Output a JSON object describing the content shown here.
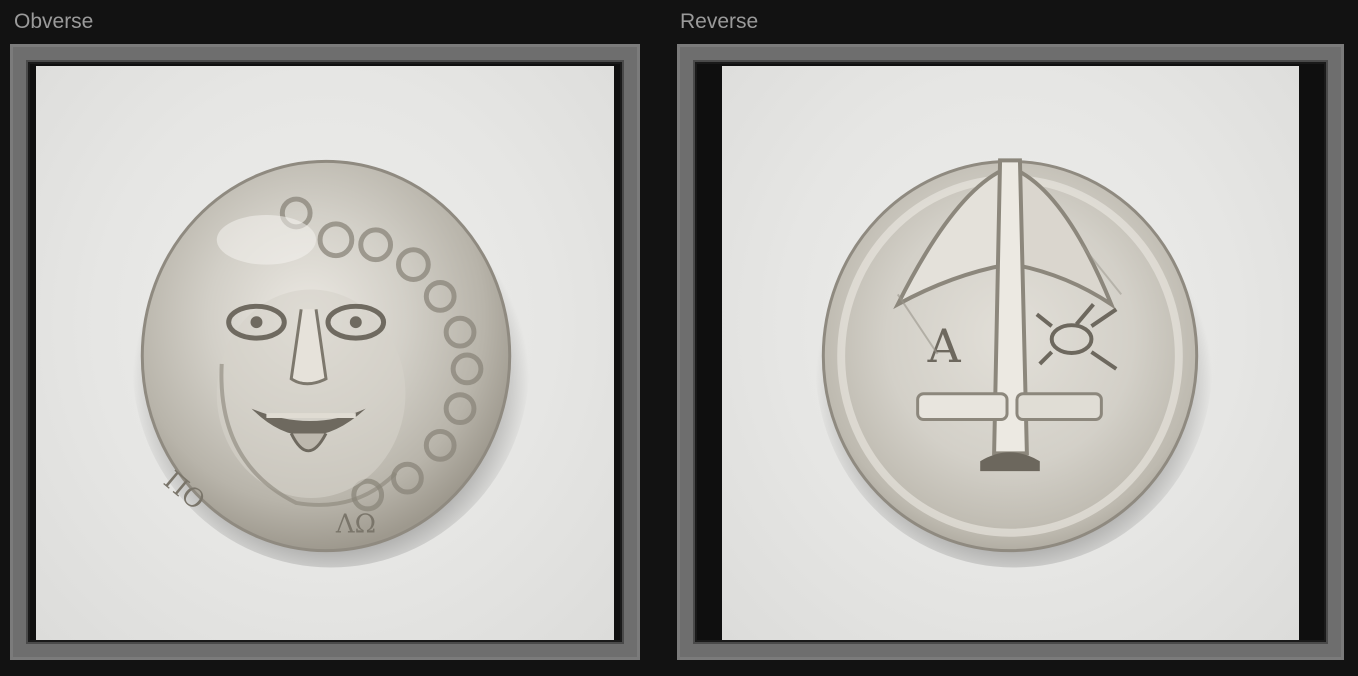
{
  "viewer": {
    "obverse": {
      "label": "Obverse",
      "image_alt": "Silver coin obverse with facing gorgoneion (Medusa head)"
    },
    "reverse": {
      "label": "Reverse",
      "image_alt": "Silver coin reverse with upturned anchor, letter A and crayfish in field"
    }
  },
  "colors": {
    "background": "#121212",
    "label_text": "#9a9a9a",
    "frame_border": "#7b7b7b",
    "photo_backdrop": "#e8e8e6",
    "coin_silver": "#c9c6bf"
  }
}
